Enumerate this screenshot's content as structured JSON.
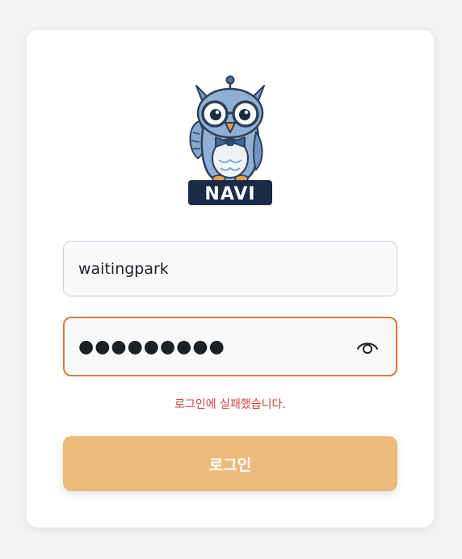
{
  "logo": {
    "text": "NAVI",
    "icon": "owl-mascot-icon"
  },
  "username": {
    "value": "waitingpark"
  },
  "password": {
    "value": "●●●●●●●●●",
    "toggle_icon": "eye-icon"
  },
  "error": {
    "message": "로그인에 실패했습니다."
  },
  "login_button": {
    "label": "로그인"
  },
  "colors": {
    "background": "#f2f3f5",
    "card": "#ffffff",
    "accent_button": "#ecba7a",
    "focus_border": "#d97a3d",
    "error_text": "#d0453b",
    "logo_banner": "#1b2a45"
  }
}
